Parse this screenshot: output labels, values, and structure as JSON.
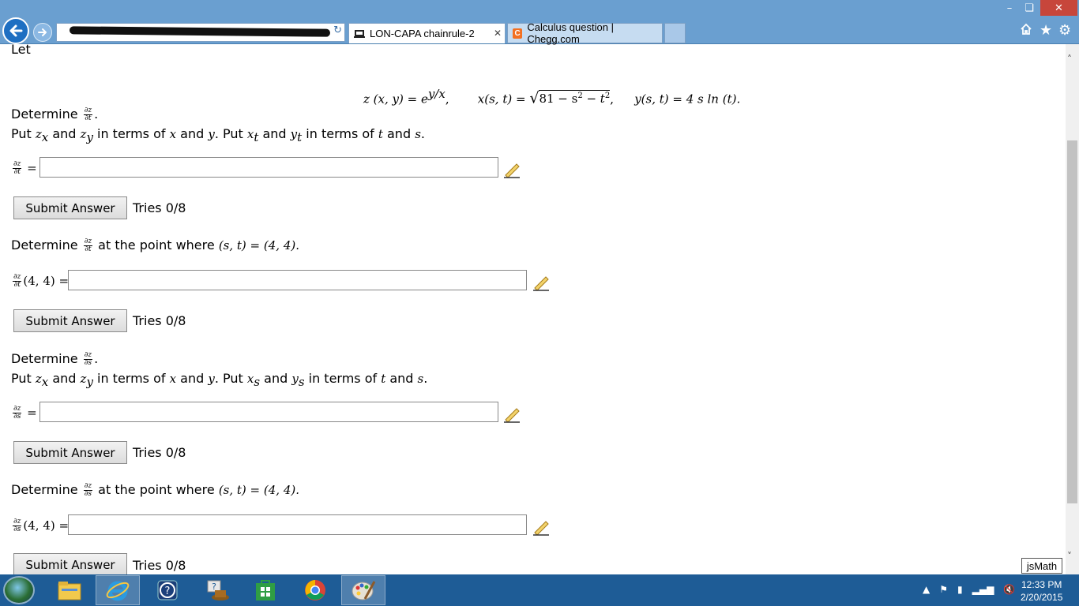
{
  "window": {
    "min_glyph": "–",
    "max_glyph": "❏",
    "close_glyph": "✕"
  },
  "tabs": [
    {
      "label": "LON-CAPA chainrule-2",
      "active": true
    },
    {
      "label": "Calculus question | Chegg.com",
      "active": false
    }
  ],
  "tab_close_glyph": "✕",
  "favicons": {
    "chegg": "C"
  },
  "toolbar_icons": [
    "home-icon",
    "star-icon",
    "gear-icon"
  ],
  "page": {
    "intro": "Let",
    "equation": {
      "z": "z (x, y) = e",
      "z_exp": "y/x",
      "x": "x(s, t) = ",
      "x_sqrt": "81 − s",
      "x_sq2": "2",
      "x_minus_t": " − t",
      "x_sq3": "2",
      "y": "y(s, t) = 4 s  ln (t)."
    },
    "sections": [
      {
        "determine": "Determine",
        "frac_num": "∂z",
        "frac_den": "∂t",
        "suffix": ".",
        "put_line": [
          "Put ",
          "z",
          "x",
          " and ",
          "z",
          "y",
          " in terms of ",
          "x",
          " and ",
          "y",
          ". Put ",
          "x",
          "t",
          " and ",
          "y",
          "t",
          " in terms of ",
          "t",
          " and ",
          "s",
          "."
        ],
        "lhs": " =",
        "submit": "Submit Answer",
        "tries": "Tries 0/8"
      },
      {
        "determine": "Determine",
        "frac_num": "∂z",
        "frac_den": "∂t",
        "suffix": " at the point where",
        "point": "(s, t) = (4, 4).",
        "lhs": "(4, 4) =",
        "submit": "Submit Answer",
        "tries": "Tries 0/8"
      },
      {
        "determine": "Determine",
        "frac_num": "∂z",
        "frac_den": "∂s",
        "suffix": ".",
        "put_line": [
          "Put ",
          "z",
          "x",
          " and ",
          "z",
          "y",
          " in terms of ",
          "x",
          " and ",
          "y",
          ". Put ",
          "x",
          "s",
          " and ",
          "y",
          "s",
          " in terms of ",
          "t",
          " and ",
          "s",
          "."
        ],
        "lhs": " =",
        "submit": "Submit Answer",
        "tries": "Tries 0/8"
      },
      {
        "determine": "Determine",
        "frac_num": "∂z",
        "frac_den": "∂s",
        "suffix": " at the point where",
        "point": "(s, t) = (4, 4).",
        "lhs": "(4, 4) =",
        "submit": "Submit Answer",
        "tries": "Tries 0/8"
      }
    ],
    "jsmath_label": "jsMath"
  },
  "taskbar": {
    "apps": [
      "start-orb",
      "file-explorer-icon",
      "internet-explorer-icon",
      "help-icon",
      "user-hat-icon",
      "store-icon",
      "chrome-icon",
      "paint-icon"
    ]
  },
  "clock": {
    "time": "12:33 PM",
    "date": "2/20/2015"
  },
  "colors": {
    "chrome": "#6a9fd0",
    "taskbar": "#1e5c96",
    "close": "#c7463b"
  }
}
